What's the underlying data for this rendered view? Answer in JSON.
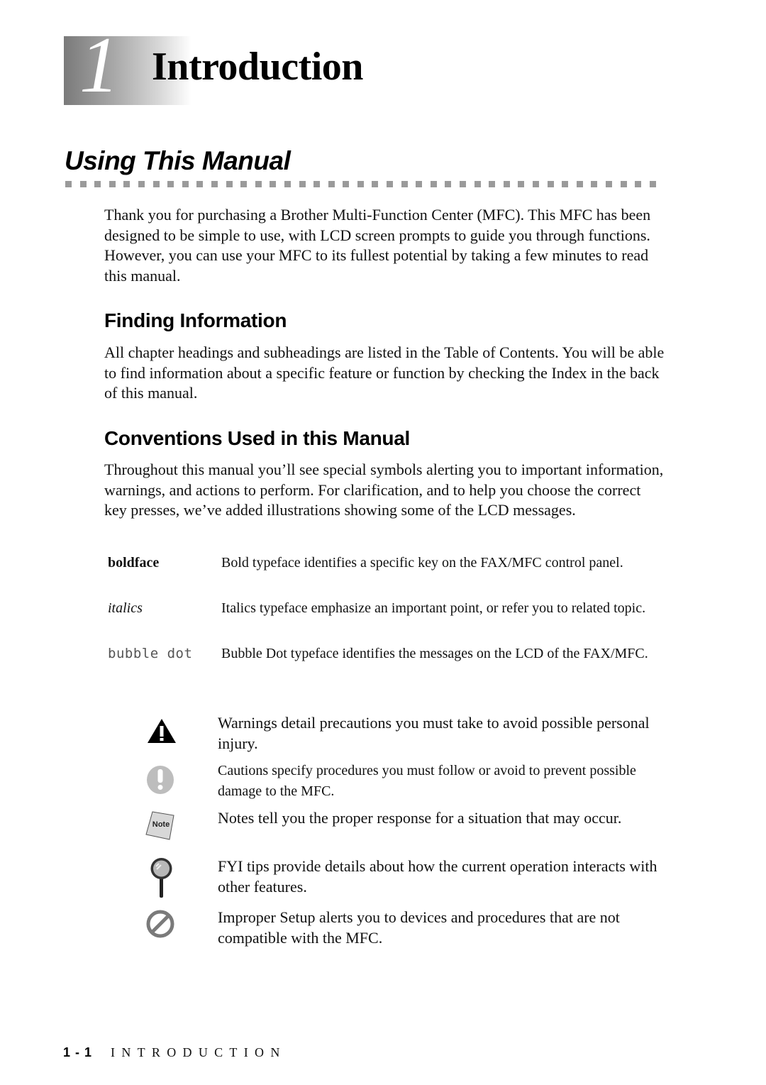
{
  "chapter": {
    "number": "1",
    "title": "Introduction"
  },
  "section": {
    "title": "Using This Manual",
    "intro": "Thank you for purchasing a Brother Multi-Function Center (MFC). This MFC has been designed to be simple to use, with LCD screen prompts to guide you through functions. However, you can use your MFC to its fullest potential by taking a few minutes to read this manual."
  },
  "finding_information": {
    "heading": "Finding Information",
    "text": "All chapter headings and subheadings are listed in the Table of Contents. You will be able to find information about a specific feature or function by checking the Index in the back of this manual."
  },
  "conventions": {
    "heading": "Conventions Used in this Manual",
    "text": "Throughout this manual you’ll see special symbols alerting you to important information, warnings, and actions to perform. For clarification, and to help you choose the correct key presses, we’ve added illustrations showing some of the LCD messages.",
    "typefaces": [
      {
        "term": "boldface",
        "style": "bold",
        "description": "Bold typeface identifies a specific key on the FAX/MFC control panel."
      },
      {
        "term": "italics",
        "style": "italic",
        "description": "Italics typeface emphasize an important point, or refer you to related topic."
      },
      {
        "term": "bubble dot",
        "style": "lcd",
        "description": "Bubble Dot typeface identifies the messages on the LCD of the FAX/MFC."
      }
    ],
    "symbols": [
      {
        "icon": "warning-triangle-icon",
        "text": "Warnings detail precautions you must take to avoid possible personal injury."
      },
      {
        "icon": "caution-exclamation-icon",
        "text": "Cautions specify procedures you must follow or avoid to prevent possible damage to the MFC."
      },
      {
        "icon": "note-icon",
        "icon_label": "Note",
        "text": "Notes tell you the proper response for a situation that may occur."
      },
      {
        "icon": "magnifier-icon",
        "text": "FYI tips provide details about how the current operation interacts with other features."
      },
      {
        "icon": "prohibited-icon",
        "text": "Improper Setup alerts you to devices and procedures that are not compatible with the MFC."
      }
    ]
  },
  "footer": {
    "page": "1 - 1",
    "label": "INTRODUCTION"
  },
  "colors": {
    "rule_dots": "#9a9a9a",
    "caution_icon": "#bdbdbd",
    "prohibited_icon": "#7a7a7a"
  }
}
